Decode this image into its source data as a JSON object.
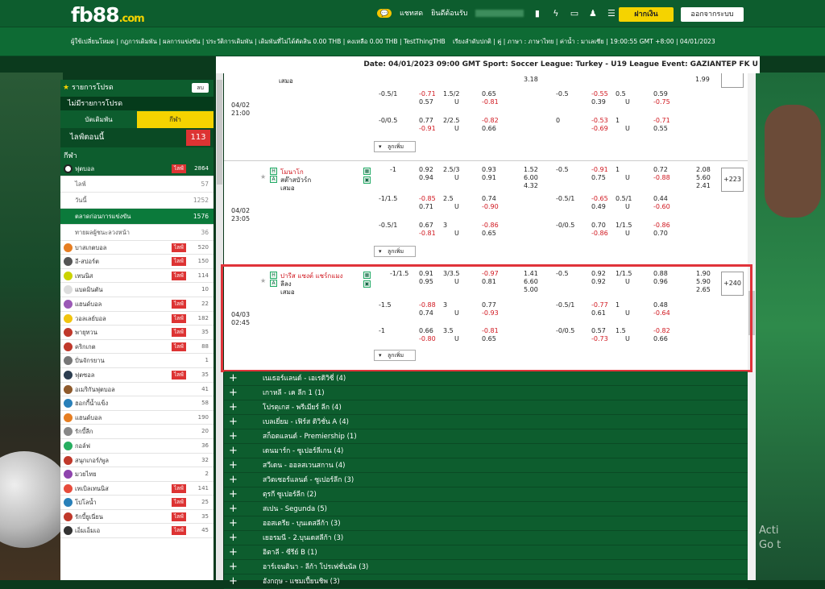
{
  "logo": {
    "main": "fb88",
    "suffix": ".com"
  },
  "header": {
    "chat_label": "แชทสด",
    "welcome": "ยินดีต้อนรับ",
    "deposit": "ฝากเงิน",
    "logout": "ออกจากระบบ"
  },
  "nav": {
    "left": "ผู้ใช้เปลี่ยนโหมด | กฎการเดิมพัน | ผลการแข่งขัน | ประวัติการเดิมพัน | เดิมพันที่ไม่ได้ตัดสิน 0.00 THB | คงเหลือ 0.00 THB | TestThingTHB",
    "right": "เรียงลำดับปกติ | คู่ | ภาษา : ภาษาไทย | ค่าน้ำ : มาเลเซีย | 19:00:55 GMT +8:00 | 04/01/2023"
  },
  "infobar": "Date: 04/01/2023 09:00 GMT Sport: Soccer League: Turkey - U19 League Event: GAZIANTEP FK U",
  "sidebar": {
    "fav_title": "รายการโปรด",
    "fav_btn": "ลบ",
    "fav_empty": "ไม่มีรายการโปรด",
    "tab_bet": "บัตเดิมพัน",
    "tab_sport": "กีฬา",
    "live_label": "ไลฟ์ตอนนี้",
    "live_count": "113",
    "sport_header": "กีฬา",
    "live_badge": "ไลฟ์",
    "football": {
      "label": "ฟุตบอล",
      "count": "2864"
    },
    "subs": [
      {
        "label": "ไลฟ์",
        "count": "57"
      },
      {
        "label": "วันนี้",
        "count": "1252"
      },
      {
        "label": "ตลาดก่อนการแข่งขัน",
        "count": "1576"
      },
      {
        "label": "ทายผลผู้ชนะลวงหน้า",
        "count": "36"
      }
    ],
    "sports": [
      {
        "label": "บาสเกตบอล",
        "count": "520",
        "live": true,
        "color": "#e67e22"
      },
      {
        "label": "อี-สปอร์ต",
        "count": "150",
        "live": true,
        "color": "#555"
      },
      {
        "label": "เทนนิส",
        "count": "114",
        "live": true,
        "color": "#cbd300"
      },
      {
        "label": "แบดมินตัน",
        "count": "10",
        "live": false,
        "color": "#ddd"
      },
      {
        "label": "แฮนด์บอล",
        "count": "22",
        "live": true,
        "color": "#9b59b6"
      },
      {
        "label": "วอลเลย์บอล",
        "count": "182",
        "live": true,
        "color": "#f1c40f"
      },
      {
        "label": "พายุทวน",
        "count": "35",
        "live": true,
        "color": "#c0392b"
      },
      {
        "label": "คริกเกต",
        "count": "88",
        "live": true,
        "color": "#c0392b"
      },
      {
        "label": "ปั่นจักรยาน",
        "count": "1",
        "live": false,
        "color": "#777"
      },
      {
        "label": "ฟุตซอล",
        "count": "35",
        "live": true,
        "color": "#2c3e50"
      },
      {
        "label": "อเมริกันฟุตบอล",
        "count": "41",
        "live": false,
        "color": "#8e5a2c"
      },
      {
        "label": "ฮอกกี้น้ำแข็ง",
        "count": "58",
        "live": false,
        "color": "#2980b9"
      },
      {
        "label": "แฮนด์บอล",
        "count": "190",
        "live": false,
        "color": "#e67e22"
      },
      {
        "label": "รักบี้ลีก",
        "count": "20",
        "live": false,
        "color": "#888"
      },
      {
        "label": "กอล์ฟ",
        "count": "36",
        "live": false,
        "color": "#27ae60"
      },
      {
        "label": "สนุกเกอร์/พูล",
        "count": "32",
        "live": false,
        "color": "#c0392b"
      },
      {
        "label": "มวยไทย",
        "count": "2",
        "live": false,
        "color": "#8e44ad"
      },
      {
        "label": "เทเบิลเทนนิส",
        "count": "141",
        "live": true,
        "color": "#e74c3c"
      },
      {
        "label": "โปโลน้ำ",
        "count": "25",
        "live": true,
        "color": "#2980b9"
      },
      {
        "label": "รักบี้ยูเนี่ยน",
        "count": "35",
        "live": true,
        "color": "#c0392b"
      },
      {
        "label": "เอ็มเอ็มเอ",
        "count": "45",
        "live": true,
        "color": "#333"
      }
    ]
  },
  "matches": {
    "more_label": "ลูกเพิ่ม",
    "m1": {
      "date": "04/02",
      "time": "21:00",
      "draw": "เสมอ",
      "top_val": "3.18",
      "top_right": "1.99",
      "r1": [
        "-0.5/1",
        "-0.71",
        "0.57",
        "1.5/2",
        "U",
        "0.65",
        "-0.81",
        "-0.5",
        "-0.55",
        "0.39",
        "0.5",
        "U",
        "0.59",
        "-0.75"
      ],
      "r2": [
        "-0/0.5",
        "0.77",
        "-0.91",
        "2/2.5",
        "U",
        "-0.82",
        "0.66",
        "0",
        "-0.53",
        "-0.69",
        "1",
        "U",
        "-0.71",
        "0.55"
      ]
    },
    "m2": {
      "date": "04/02",
      "time": "23:05",
      "home": "โมนาโก",
      "away": "สต๊าสบัวร์ก",
      "draw": "เสมอ",
      "plus": "+223",
      "r0": [
        "-1",
        "0.92",
        "0.94",
        "2.5/3",
        "U",
        "0.93",
        "0.91",
        "1.52",
        "6.00",
        "4.32",
        "-0.5",
        "-0.91",
        "0.75",
        "1",
        "U",
        "0.72",
        "-0.88",
        "2.08",
        "5.60",
        "2.41"
      ],
      "r1": [
        "-1/1.5",
        "-0.85",
        "0.71",
        "2.5",
        "U",
        "0.74",
        "-0.90",
        "-0.5/1",
        "-0.65",
        "0.49",
        "0.5/1",
        "U",
        "0.44",
        "-0.60"
      ],
      "r2": [
        "-0.5/1",
        "0.67",
        "-0.81",
        "3",
        "U",
        "-0.86",
        "0.65",
        "-0/0.5",
        "0.70",
        "-0.86",
        "1/1.5",
        "U",
        "-0.86",
        "0.70"
      ]
    },
    "m3": {
      "date": "04/03",
      "time": "02:45",
      "home": "ปารีส แซงต์ แชร์กแมง",
      "away": "ลีลง",
      "draw": "เสมอ",
      "plus": "+240",
      "r0": [
        "-1/1.5",
        "0.91",
        "0.95",
        "3/3.5",
        "U",
        "-0.97",
        "0.81",
        "1.41",
        "6.60",
        "5.00",
        "-0.5",
        "0.92",
        "0.92",
        "1/1.5",
        "U",
        "0.88",
        "0.96",
        "1.90",
        "5.90",
        "2.65"
      ],
      "r1": [
        "-1.5",
        "-0.88",
        "0.74",
        "3",
        "U",
        "0.77",
        "-0.93",
        "-0.5/1",
        "-0.77",
        "0.61",
        "1",
        "U",
        "0.48",
        "-0.64"
      ],
      "r2": [
        "-1",
        "0.66",
        "-0.80",
        "3.5",
        "U",
        "-0.81",
        "0.65",
        "-0/0.5",
        "0.57",
        "-0.73",
        "1.5",
        "U",
        "-0.82",
        "0.66"
      ]
    }
  },
  "leagues": [
    "เนเธอร์แลนด์ - เอเรดิวิซี่ (4)",
    "เกาหลี - เค ลีก 1 (1)",
    "โปรตุเกส - พรีเมียร์ ลีก (4)",
    "เบลเยี่ยม - เฟิร์ส ดิวิชั่น A (4)",
    "สก็อตแลนด์ - Premiership (1)",
    "เดนมาร์ก - ซูเปอร์ลีเกน (4)",
    "สวีเดน - ออลสเวนสกาน (4)",
    "สวิตเซอร์แลนด์ - ซูเปอร์ลีก (3)",
    "ตุรกี ซูเปอร์ลีก (2)",
    "สเปน - Segunda (5)",
    "ออสเตรีย - บุนเดสลีก้า (3)",
    "เยอรมนี - 2.บุนเดสลีก้า (3)",
    "อิตาลี - ซีรีย์ B (1)",
    "อาร์เจนตินา - ลีก้า โปรเฟชั่นนัล (3)",
    "อังกฤษ - แชมเปี้ยนชิพ (3)"
  ],
  "bg": {
    "activate_1": "Acti",
    "activate_2": "Go t"
  }
}
